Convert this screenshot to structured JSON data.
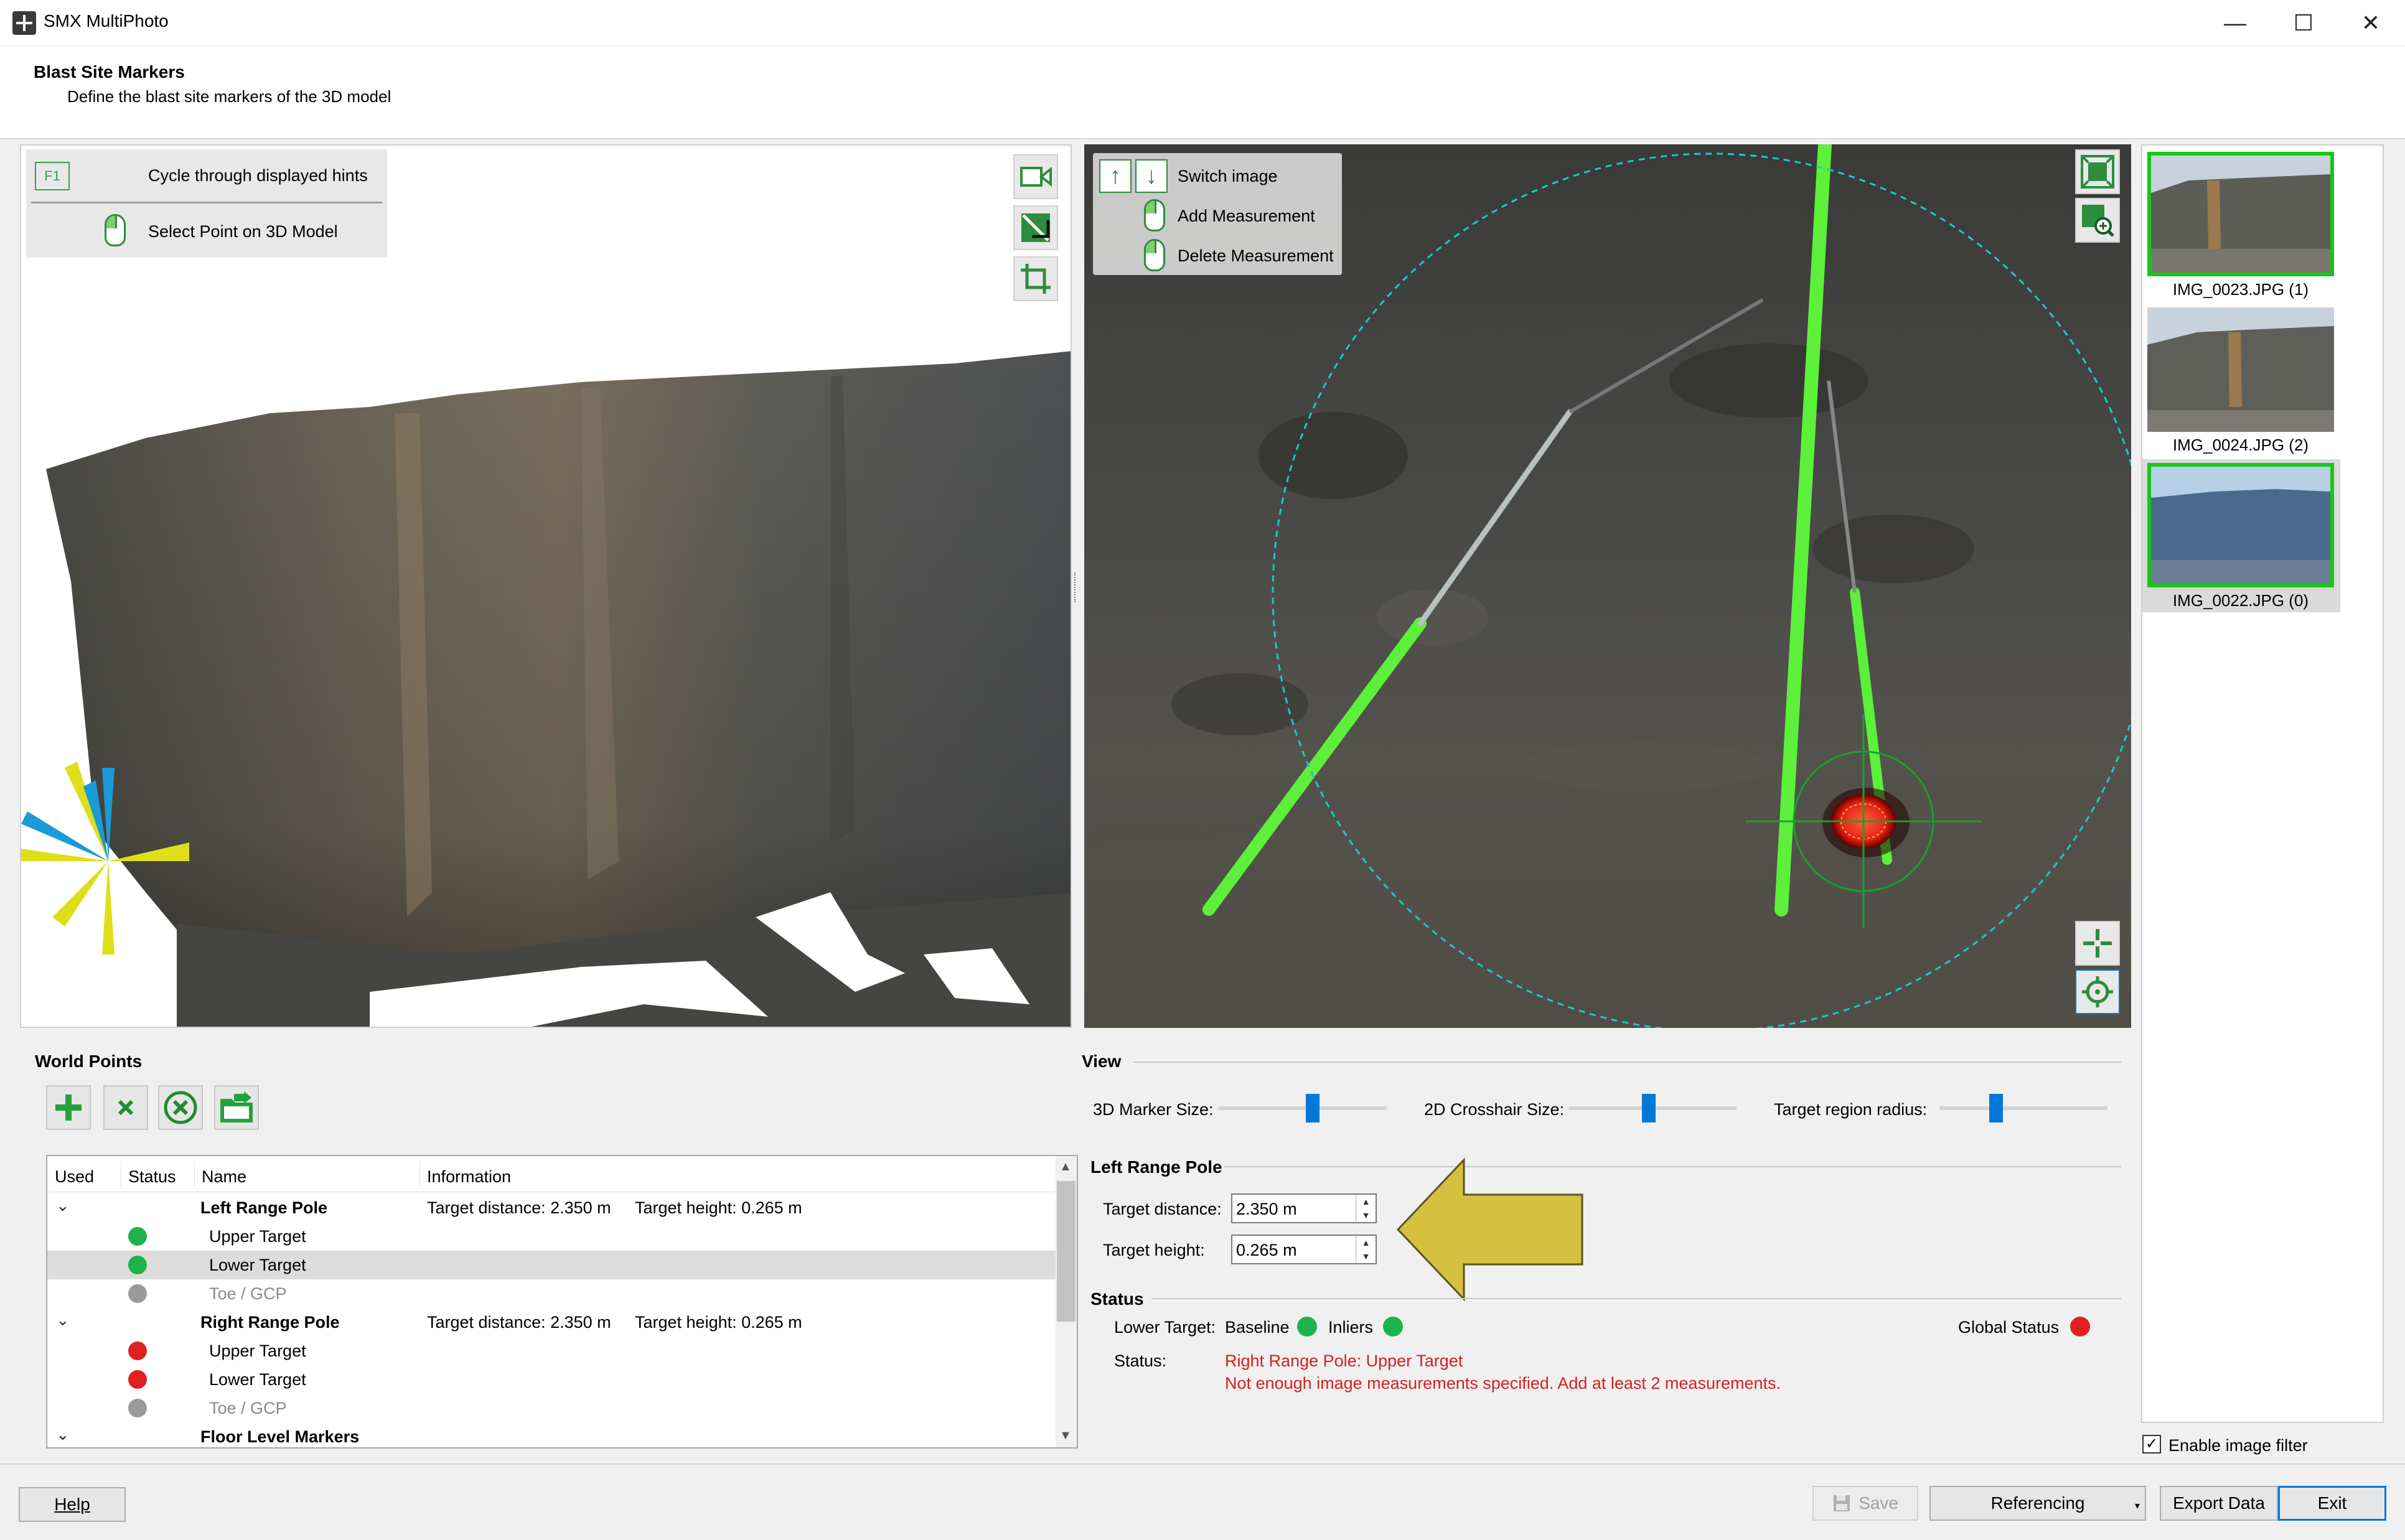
{
  "window": {
    "title": "SMX MultiPhoto",
    "minimize": "—",
    "maximize": "☐",
    "close": "✕"
  },
  "header": {
    "title": "Blast Site Markers",
    "subtitle": "Define the blast site markers of the 3D model"
  },
  "view3d": {
    "hints": {
      "key": "F1",
      "cycle": "Cycle through displayed hints",
      "select": "Select Point on 3D Model"
    },
    "tools": [
      "camera-icon",
      "clip-icon",
      "crop-icon"
    ]
  },
  "image_view": {
    "hints": {
      "switch": "Switch image",
      "add": "Add Measurement",
      "delete": "Delete Measurement"
    },
    "tools_top": [
      "fit-view-icon",
      "zoom-region-icon"
    ],
    "tools_bottom": [
      "crosshair-icon",
      "center-target-icon"
    ]
  },
  "thumbnails": [
    {
      "label": "IMG_0023.JPG (1)",
      "selected": true
    },
    {
      "label": "IMG_0024.JPG (2)",
      "selected": false
    },
    {
      "label": "IMG_0022.JPG (0)",
      "selected": true
    }
  ],
  "enable_image_filter": {
    "label": "Enable image filter",
    "checked": true
  },
  "world_points": {
    "title": "World Points",
    "tools": [
      "add-icon",
      "remove-icon",
      "clear-icon",
      "import-icon"
    ],
    "columns": [
      "Used",
      "Status",
      "Name",
      "Information"
    ],
    "rows": [
      {
        "type": "group",
        "name": "Left Range Pole",
        "info1": "Target distance: 2.350 m",
        "info2": "Target height: 0.265 m"
      },
      {
        "type": "item",
        "name": "Upper Target",
        "status": "green"
      },
      {
        "type": "item",
        "name": "Lower Target",
        "status": "green",
        "selected": true
      },
      {
        "type": "item",
        "name": "Toe / GCP",
        "status": "gray",
        "disabled": true
      },
      {
        "type": "group",
        "name": "Right Range Pole",
        "info1": "Target distance: 2.350 m",
        "info2": "Target height: 0.265 m"
      },
      {
        "type": "item",
        "name": "Upper Target",
        "status": "red"
      },
      {
        "type": "item",
        "name": "Lower Target",
        "status": "red"
      },
      {
        "type": "item",
        "name": "Toe / GCP",
        "status": "gray",
        "disabled": true
      },
      {
        "type": "group",
        "name": "Floor Level Markers",
        "info1": "",
        "info2": ""
      }
    ]
  },
  "view_section": {
    "title": "View",
    "marker_size_label": "3D Marker Size:",
    "crosshair_size_label": "2D Crosshair Size:",
    "target_radius_label": "Target region radius:",
    "marker_size_value": 0.55,
    "crosshair_size_value": 0.47,
    "target_radius_value": 0.35
  },
  "pole_section": {
    "title": "Left Range Pole",
    "distance_label": "Target distance:",
    "distance_value": "2.350 m",
    "height_label": "Target height:",
    "height_value": "0.265 m"
  },
  "status_section": {
    "title": "Status",
    "lower_target_label": "Lower Target:",
    "baseline_label": "Baseline",
    "inliers_label": "Inliers",
    "global_label": "Global Status",
    "status_label": "Status:",
    "message_line1": "Right Range Pole: Upper Target",
    "message_line2": "Not enough image measurements specified. Add at least 2 measurements.",
    "colors": {
      "ok": "#1db34a",
      "error": "#e02020",
      "message": "#d42020"
    }
  },
  "buttons": {
    "help": "Help",
    "save": "Save",
    "referencing": "Referencing",
    "export": "Export Data",
    "exit": "Exit"
  }
}
